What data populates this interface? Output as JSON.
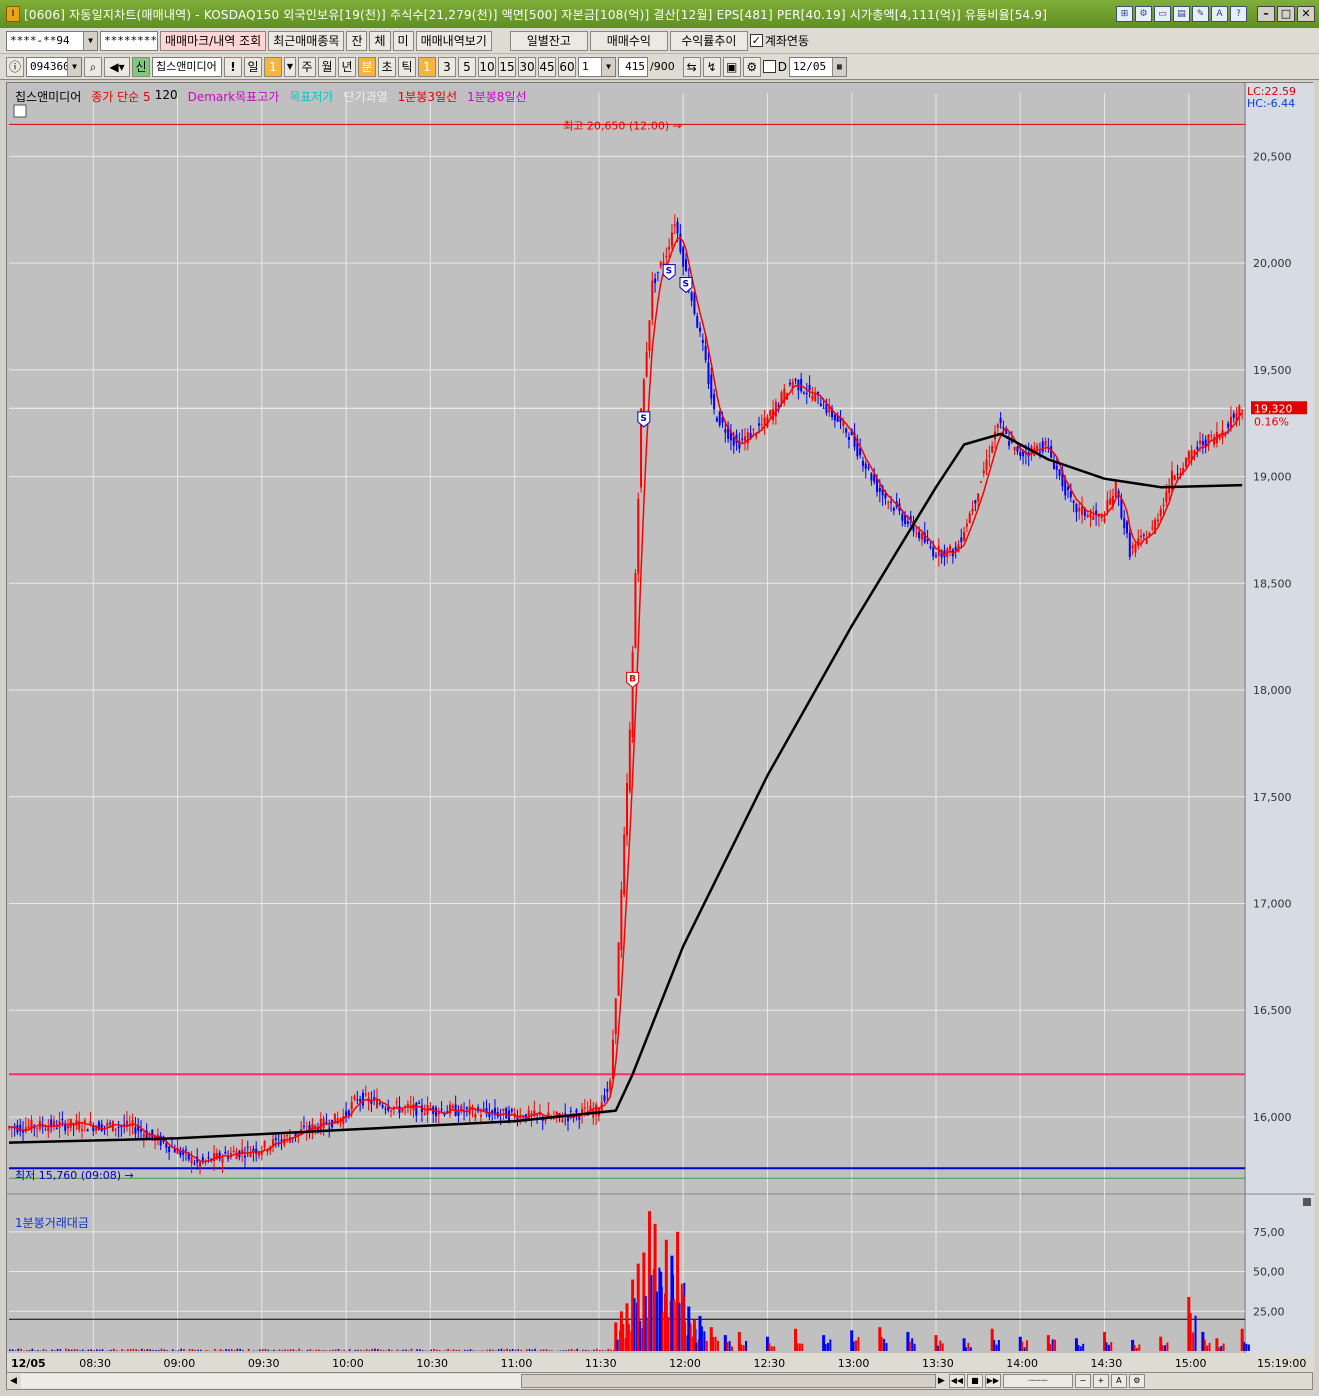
{
  "window": {
    "title": "[0606] 자동일지차트(매매내역) - KOSDAQ150 외국인보유[19(천)] 주식수[21,279(천)] 액면[500] 자본금[108(억)] 결산[12월] EPS[481] PER[40.19] 시가총액[4,111(억)] 유통비율[54.9]"
  },
  "toolbar1": {
    "account": "****-**94",
    "password": "********",
    "buttons": [
      "매매마크/내역 조회",
      "최근매매종목",
      "잔",
      "체",
      "미",
      "매매내역보기"
    ],
    "right_buttons": [
      "일별잔고",
      "매매수익",
      "수익률추이"
    ],
    "account_link_label": "계좌연동",
    "account_link_checked": "✓"
  },
  "toolbar2": {
    "code": "094360",
    "stock_name": "칩스앤미디어",
    "new_badge": "신",
    "exclaim": "!",
    "period_buttons": [
      "일",
      "1",
      "주",
      "월",
      "년",
      "분",
      "초",
      "틱"
    ],
    "interval_buttons": [
      "1",
      "3",
      "5",
      "10",
      "15",
      "30",
      "45",
      "60"
    ],
    "count_select": "1",
    "count_value": "415",
    "count_max": "/900",
    "date_check_label": "D",
    "date": "12/05"
  },
  "legend": {
    "name": "칩스앤미디어",
    "ma": "종가 단순 5",
    "ma2": "120",
    "demark_high": "Demark목표고가",
    "demark_low": "목표저가",
    "short_overheat": "단기과열",
    "line3": "1분봉3일선",
    "line8": "1분봉8일선"
  },
  "info": {
    "lc": "LC:22.59",
    "hc": "HC:-6.44"
  },
  "current": {
    "price": "19,320",
    "change": "0.16%"
  },
  "annotations": {
    "high": "최고 20,650 (12:00)",
    "low": "최저 15,760 (09:08)"
  },
  "volume_legend": "1분봉거래대금",
  "colors": {
    "up": "#ff0000",
    "down": "#0000ff",
    "ma5": "#ff0000",
    "ma120": "#000000",
    "hl_line": "#ff2a6d",
    "low_line": "#0000cc"
  },
  "chart_data": {
    "type": "candlestick",
    "date": "12/05",
    "y_ticks": [
      20500,
      20000,
      19500,
      19000,
      18500,
      18000,
      17500,
      17000,
      16500,
      16000
    ],
    "y_tick_labels": [
      "20,500",
      "20,000",
      "19,500",
      "19,000",
      "18,500",
      "18,000",
      "17,500",
      "17,000",
      "16,500",
      "16,000"
    ],
    "ylim": [
      15700,
      20750
    ],
    "x_labels": [
      "12/05",
      "08:30",
      "09:00",
      "09:30",
      "10:00",
      "10:30",
      "11:00",
      "11:30",
      "12:00",
      "12:30",
      "13:00",
      "13:30",
      "14:00",
      "14:30",
      "15:00",
      "15:19:00"
    ],
    "high": 20650,
    "low": 15760,
    "last": 19320,
    "hline": 16200,
    "price_path": [
      [
        "08:00",
        15950
      ],
      [
        "08:20",
        15965
      ],
      [
        "08:45",
        15955
      ],
      [
        "09:00",
        15850
      ],
      [
        "09:08",
        15780
      ],
      [
        "09:20",
        15830
      ],
      [
        "09:30",
        15850
      ],
      [
        "09:45",
        15930
      ],
      [
        "10:00",
        16000
      ],
      [
        "10:05",
        16090
      ],
      [
        "10:20",
        16040
      ],
      [
        "10:40",
        16030
      ],
      [
        "11:00",
        16010
      ],
      [
        "11:15",
        15995
      ],
      [
        "11:30",
        16030
      ],
      [
        "11:35",
        16150
      ],
      [
        "11:38",
        16800
      ],
      [
        "11:42",
        17800
      ],
      [
        "11:46",
        19300
      ],
      [
        "11:50",
        19900
      ],
      [
        "11:55",
        20050
      ],
      [
        "11:58",
        20200
      ],
      [
        "12:02",
        19950
      ],
      [
        "12:08",
        19600
      ],
      [
        "12:12",
        19300
      ],
      [
        "12:20",
        19150
      ],
      [
        "12:30",
        19250
      ],
      [
        "12:40",
        19450
      ],
      [
        "12:50",
        19350
      ],
      [
        "13:00",
        19200
      ],
      [
        "13:10",
        18950
      ],
      [
        "13:20",
        18800
      ],
      [
        "13:30",
        18650
      ],
      [
        "13:38",
        18650
      ],
      [
        "13:45",
        18900
      ],
      [
        "13:53",
        19250
      ],
      [
        "14:00",
        19100
      ],
      [
        "14:10",
        19150
      ],
      [
        "14:20",
        18850
      ],
      [
        "14:30",
        18800
      ],
      [
        "14:35",
        18950
      ],
      [
        "14:40",
        18650
      ],
      [
        "14:48",
        18750
      ],
      [
        "14:55",
        19000
      ],
      [
        "15:05",
        19150
      ],
      [
        "15:12",
        19200
      ],
      [
        "15:19",
        19320
      ]
    ],
    "ma120_path": [
      [
        "08:00",
        15880
      ],
      [
        "09:00",
        15900
      ],
      [
        "10:00",
        15940
      ],
      [
        "11:00",
        15980
      ],
      [
        "11:36",
        16030
      ],
      [
        "11:42",
        16200
      ],
      [
        "12:00",
        16800
      ],
      [
        "12:30",
        17600
      ],
      [
        "13:00",
        18300
      ],
      [
        "13:30",
        18950
      ],
      [
        "13:40",
        19150
      ],
      [
        "13:53",
        19200
      ],
      [
        "14:10",
        19080
      ],
      [
        "14:30",
        18990
      ],
      [
        "14:50",
        18950
      ],
      [
        "15:19",
        18960
      ]
    ],
    "volume": {
      "y_ticks": [
        25,
        50,
        75
      ],
      "y_tick_labels": [
        "25,00",
        "50,00",
        "75,00"
      ],
      "ylim": [
        0,
        90
      ],
      "bars": [
        [
          "11:36",
          18,
          "up"
        ],
        [
          "11:38",
          25,
          "up"
        ],
        [
          "11:40",
          30,
          "up"
        ],
        [
          "11:42",
          45,
          "up"
        ],
        [
          "11:44",
          55,
          "up"
        ],
        [
          "11:46",
          62,
          "up"
        ],
        [
          "11:48",
          88,
          "up"
        ],
        [
          "11:50",
          80,
          "up"
        ],
        [
          "11:52",
          50,
          "down"
        ],
        [
          "11:54",
          70,
          "up"
        ],
        [
          "11:56",
          60,
          "down"
        ],
        [
          "11:58",
          75,
          "up"
        ],
        [
          "12:00",
          35,
          "up"
        ],
        [
          "12:02",
          28,
          "down"
        ],
        [
          "12:04",
          20,
          "up"
        ],
        [
          "12:06",
          22,
          "down"
        ],
        [
          "12:10",
          15,
          "up"
        ],
        [
          "12:15",
          10,
          "down"
        ],
        [
          "12:20",
          12,
          "up"
        ],
        [
          "12:30",
          9,
          "down"
        ],
        [
          "12:40",
          14,
          "up"
        ],
        [
          "12:50",
          10,
          "down"
        ],
        [
          "13:00",
          13,
          "down"
        ],
        [
          "13:10",
          15,
          "up"
        ],
        [
          "13:20",
          12,
          "down"
        ],
        [
          "13:30",
          10,
          "up"
        ],
        [
          "13:40",
          8,
          "down"
        ],
        [
          "13:50",
          14,
          "up"
        ],
        [
          "14:00",
          9,
          "down"
        ],
        [
          "14:10",
          10,
          "up"
        ],
        [
          "14:20",
          8,
          "down"
        ],
        [
          "14:30",
          12,
          "up"
        ],
        [
          "14:40",
          7,
          "down"
        ],
        [
          "14:50",
          9,
          "up"
        ],
        [
          "15:00",
          34,
          "up"
        ],
        [
          "15:05",
          12,
          "down"
        ],
        [
          "15:10",
          8,
          "up"
        ],
        [
          "15:19",
          14,
          "up"
        ]
      ]
    },
    "trade_marks": [
      {
        "label": "B",
        "time": "11:42",
        "price": 18050
      },
      {
        "label": "S",
        "time": "11:46",
        "price": 19270
      },
      {
        "label": "S",
        "time": "11:55",
        "price": 19960
      },
      {
        "label": "S",
        "time": "12:01",
        "price": 19900
      }
    ]
  }
}
